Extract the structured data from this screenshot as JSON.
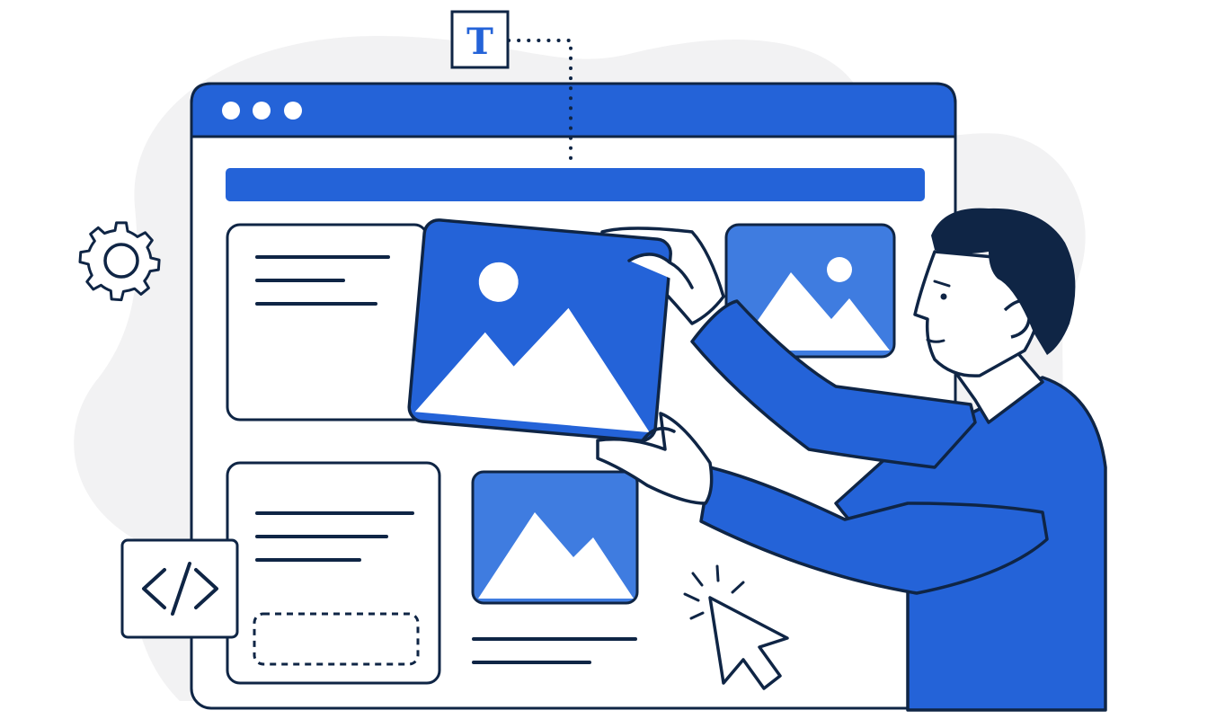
{
  "illustration": {
    "colors": {
      "brand_blue": "#2463d8",
      "light_blue": "#3f7ce0",
      "outline": "#0f2545",
      "page_bg": "#ffffff",
      "blob_gray": "#f2f2f3",
      "canvas": "#ffffff",
      "skin": "#ffffff",
      "hair": "#0f2545"
    },
    "text_tool": {
      "glyph": "T",
      "icon": "text-tool-icon"
    },
    "code_tool": {
      "glyph": "</>",
      "icon": "code-icon"
    },
    "gear": {
      "icon": "gear-icon"
    },
    "window": {
      "controls": [
        "window-dot",
        "window-dot",
        "window-dot"
      ]
    },
    "cursor": {
      "icon": "mouse-pointer-icon"
    }
  }
}
